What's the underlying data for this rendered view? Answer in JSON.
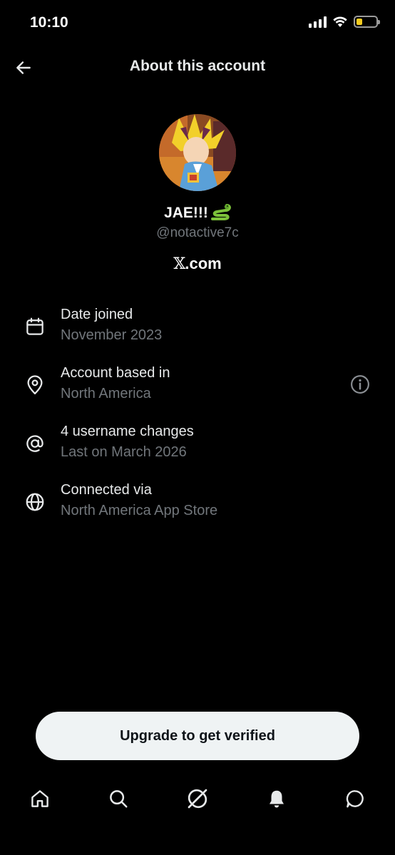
{
  "status_bar": {
    "time": "10:10",
    "battery_color": "#f5cc1f"
  },
  "header": {
    "title": "About this account",
    "back_icon": "arrow-left-icon"
  },
  "profile": {
    "display_name": "JAE!!!",
    "name_emoji": "snake-icon",
    "handle": "@notactive7c",
    "site_mark": "𝕏",
    "site_suffix": ".com"
  },
  "info_rows": [
    {
      "icon": "calendar-icon",
      "title": "Date joined",
      "subtitle": "November 2023"
    },
    {
      "icon": "location-pin-icon",
      "title": "Account based in",
      "subtitle": "North America",
      "action_icon": "info-icon"
    },
    {
      "icon": "at-sign-icon",
      "title": "4 username changes",
      "subtitle": "Last on March 2026"
    },
    {
      "icon": "globe-icon",
      "title": "Connected via",
      "subtitle": "North America App Store"
    }
  ],
  "cta": {
    "label": "Upgrade to get verified"
  },
  "bottom_nav": [
    "home-icon",
    "search-icon",
    "grok-icon",
    "notifications-icon",
    "messages-icon"
  ],
  "colors": {
    "background": "#000000",
    "primary_text": "#e7e9ea",
    "secondary_text": "#71767b",
    "cta_bg": "#eff3f4"
  }
}
